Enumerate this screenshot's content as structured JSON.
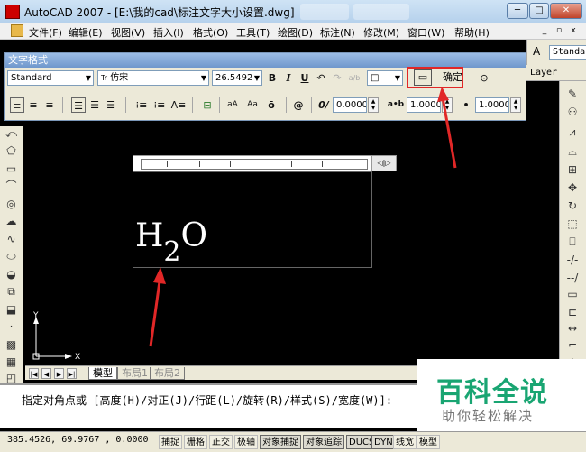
{
  "window": {
    "title": "AutoCAD 2007 - [E:\\我的cad\\标注文字大小设置.dwg]",
    "minimize": "─",
    "maximize": "□",
    "close": "✕"
  },
  "menu": {
    "items": [
      "文件(F)",
      "编辑(E)",
      "视图(V)",
      "插入(I)",
      "格式(O)",
      "工具(T)",
      "绘图(D)",
      "标注(N)",
      "修改(M)",
      "窗口(W)",
      "帮助(H)"
    ],
    "mdi_min": "_",
    "mdi_max": "▫",
    "mdi_close": "x"
  },
  "right_toolbar": {
    "style_value": "Standa",
    "layer_label": "Layer"
  },
  "text_format": {
    "title": "文字格式",
    "style": "Standard",
    "font": "仿宋",
    "font_prefix": "Tr",
    "height": "26.5492",
    "bold": "B",
    "italic": "I",
    "underline": "U",
    "undo": "↶",
    "redo": "↷",
    "stack": "a/b",
    "color": "□",
    "ruler_button": "▭",
    "ok": "确定",
    "options": "⊙",
    "oblique_label": "0/",
    "oblique_value": "0.0000",
    "tracking_label": "a•b",
    "tracking_value": "1.0000",
    "width_label": "•",
    "width_value": "1.0000",
    "symbol": "@",
    "uppercase": "aA",
    "lowercase": "Aa",
    "overline": "ō"
  },
  "editor": {
    "text_main": "H",
    "text_sub": "2",
    "text_tail": "O",
    "ruler_end": "◁|▷"
  },
  "ucs": {
    "x_label": "X",
    "y_label": "Y"
  },
  "layout_tabs": {
    "nav": [
      "|◀",
      "◀",
      "▶",
      "▶|"
    ],
    "tabs": [
      "模型",
      "布局1",
      "布局2"
    ]
  },
  "command": {
    "prompt": "指定对角点或 [高度(H)/对正(J)/行距(L)/旋转(R)/样式(S)/宽度(W)]:"
  },
  "status": {
    "coords": "385.4526, 69.9767 , 0.0000",
    "buttons": [
      "捕捉",
      "栅格",
      "正交",
      "极轴",
      "对象捕捉",
      "对象追踪",
      "DUCS",
      "DYN",
      "线宽",
      "模型"
    ]
  },
  "watermark": {
    "main": "百科全说",
    "sub": "助你轻松解决"
  },
  "colors": {
    "highlight": "#e12727",
    "watermark_green": "#19a572",
    "canvas": "#000000"
  }
}
